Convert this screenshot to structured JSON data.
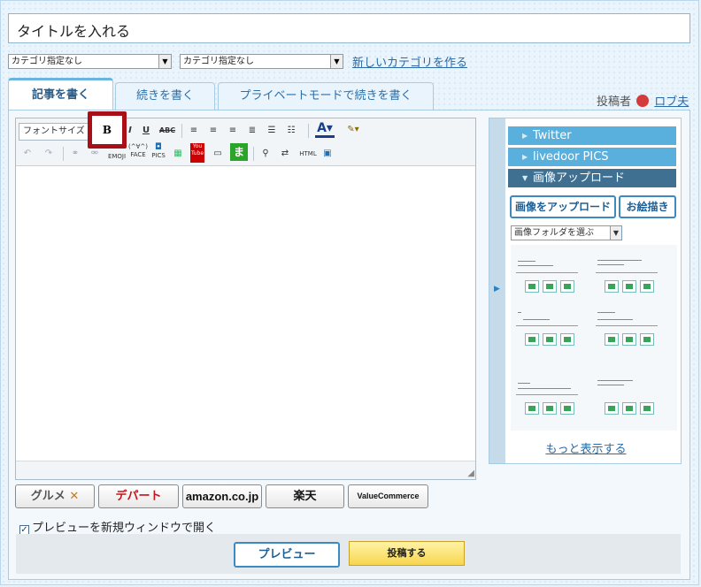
{
  "title_input": {
    "value": "タイトルを入れる"
  },
  "category_select_1": {
    "value": "カテゴリ指定なし"
  },
  "category_select_2": {
    "value": "カテゴリ指定なし"
  },
  "new_category_link": "新しいカテゴリを作る",
  "tabs": [
    {
      "label": "記事を書く",
      "active": true
    },
    {
      "label": "続きを書く",
      "active": false
    },
    {
      "label": "プライベートモードで続きを書く",
      "active": false
    }
  ],
  "author": {
    "label": "投稿者",
    "name": "ロブ夫"
  },
  "toolbar": {
    "font_size_select": "フォントサイズ",
    "bold": "B",
    "italic": "I",
    "underline": "U",
    "strike": "ABC",
    "emoji": "EMOJI",
    "face": "FACE",
    "face_glyph": "(^∀^)",
    "pics": "PICS",
    "youtube": "You Tube",
    "ma": "ま",
    "html": "HTML"
  },
  "side": {
    "accordion": [
      "Twitter",
      "livedoor PICS",
      "画像アップロード"
    ],
    "upload_button": "画像をアップロード",
    "draw_button": "お絵描き",
    "folder_select": "画像フォルダを選ぶ",
    "more_link": "もっと表示する"
  },
  "affiliates": [
    "グルメ",
    "デパート",
    "amazon.co.jp",
    "楽天",
    "ValueCommerce"
  ],
  "preview_checkbox": {
    "label": "プレビューを新規ウィンドウで開く",
    "checked": true
  },
  "preview_button": "プレビュー",
  "post_button": "投稿する",
  "colors": {
    "accent": "#5ab0dc",
    "dark_accent": "#3f7091",
    "highlight": "#a80f16",
    "post": "#f7d64d"
  }
}
